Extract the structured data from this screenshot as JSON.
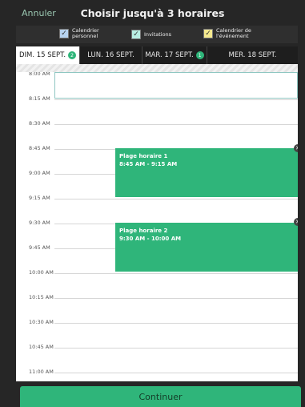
{
  "header": {
    "cancel_label": "Annuler",
    "title": "Choisir jusqu'à 3 horaires"
  },
  "legend": [
    {
      "label_line1": "Calendrier",
      "label_line2": "personnel",
      "color": "#b7d3f0",
      "checked": true
    },
    {
      "label_line1": "Invitations",
      "label_line2": "",
      "color": "#b9efe3",
      "checked": true
    },
    {
      "label_line1": "Calendrier de",
      "label_line2": "l'événement",
      "color": "#f5ea8f",
      "checked": true
    }
  ],
  "tabs": [
    {
      "label": "DIM. 15 SEPT.",
      "badge": "2",
      "active": true
    },
    {
      "label": "LUN. 16 SEPT.",
      "badge": "",
      "active": false
    },
    {
      "label": "MAR. 17 SEPT.",
      "badge": "1",
      "active": false
    },
    {
      "label": "MER. 18 SEPT.",
      "badge": "",
      "active": false
    }
  ],
  "time_labels": [
    "8:00 AM",
    "8:15 AM",
    "8:30 AM",
    "8:45 AM",
    "9:00 AM",
    "9:15 AM",
    "9:30 AM",
    "9:45 AM",
    "10:00 AM",
    "10:15 AM",
    "10:30 AM",
    "10:45 AM",
    "11:00 AM"
  ],
  "events": [
    {
      "title": "Plage horaire 1",
      "time": "8:45 AM - 9:15 AM",
      "start": "8:45 AM",
      "end": "9:15 AM"
    },
    {
      "title": "Plage horaire 2",
      "time": "9:30 AM - 10:00 AM",
      "start": "9:30 AM",
      "end": "10:00 AM"
    }
  ],
  "continue_label": "Continuer",
  "colors": {
    "accent": "#2fb57a",
    "background": "#262626"
  }
}
